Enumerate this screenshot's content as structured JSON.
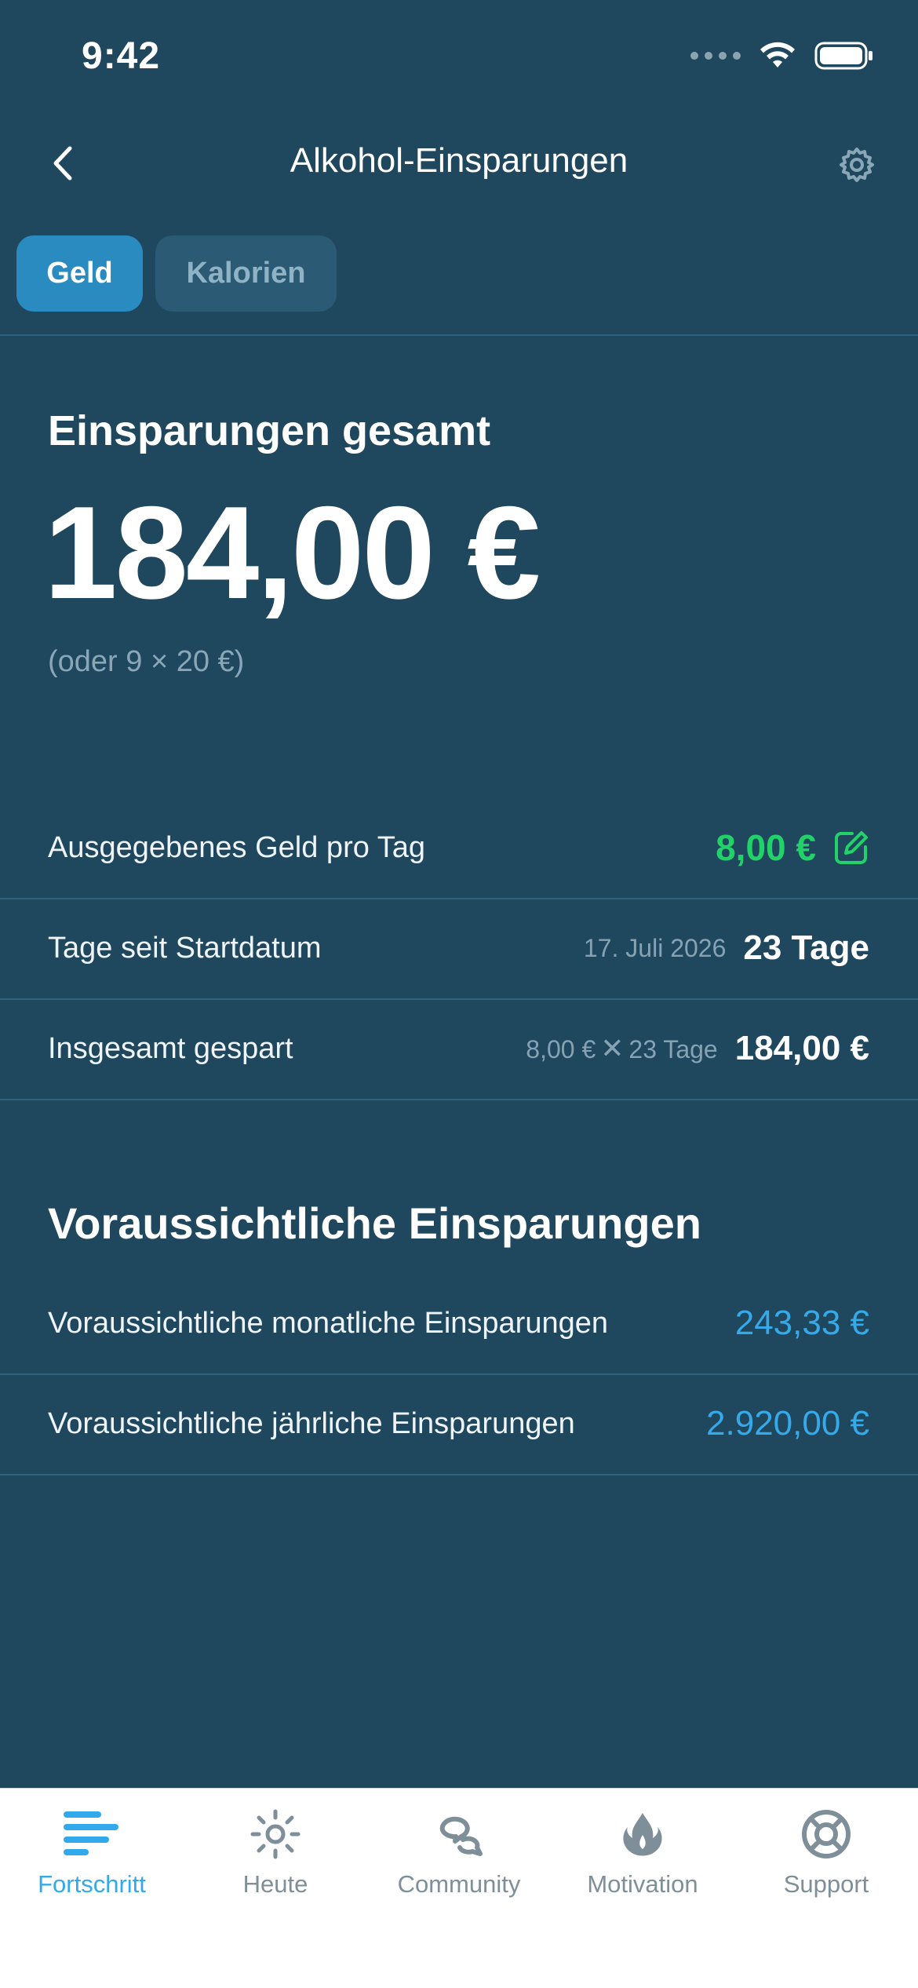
{
  "status_bar": {
    "time": "9:42"
  },
  "nav": {
    "title": "Alkohol-Einsparungen"
  },
  "tabs": [
    {
      "label": "Geld",
      "active": true
    },
    {
      "label": "Kalorien",
      "active": false
    }
  ],
  "summary": {
    "heading": "Einsparungen gesamt",
    "amount": "184,00 €",
    "equivalent": "(oder 9 × 20 €)"
  },
  "details": {
    "per_day": {
      "label": "Ausgegebenes Geld pro Tag",
      "value": "8,00 €"
    },
    "days": {
      "label": "Tage seit Startdatum",
      "start_date": "17. Juli 2026",
      "value": "23 Tage"
    },
    "total": {
      "label": "Insgesamt gespart",
      "formula_left": "8,00 €",
      "times": "✕",
      "formula_right": "23 Tage",
      "value": "184,00 €"
    }
  },
  "projection": {
    "heading": "Voraussichtliche Einsparungen",
    "monthly": {
      "label": "Voraussichtliche monatliche Einsparungen",
      "value": "243,33 €"
    },
    "yearly": {
      "label": "Voraussichtliche jährliche Einsparungen",
      "value": "2.920,00 €"
    }
  },
  "tab_bar": {
    "items": [
      {
        "label": "Fortschritt",
        "icon": "progress-bars-icon",
        "active": true
      },
      {
        "label": "Heute",
        "icon": "sun-icon",
        "active": false
      },
      {
        "label": "Community",
        "icon": "chat-bubbles-icon",
        "active": false
      },
      {
        "label": "Motivation",
        "icon": "flame-icon",
        "active": false
      },
      {
        "label": "Support",
        "icon": "lifebuoy-icon",
        "active": false
      }
    ]
  },
  "colors": {
    "background": "#1f475e",
    "accent_green": "#23d169",
    "accent_blue": "#36a9e8",
    "tab_active": "#2a8bc0",
    "tab_bar_active": "#32a9ec"
  }
}
